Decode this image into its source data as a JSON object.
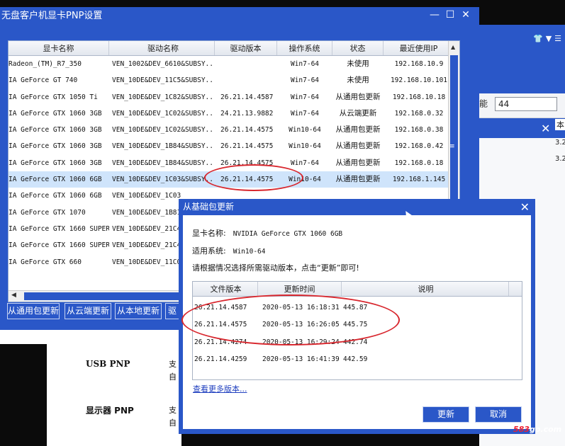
{
  "main_window": {
    "title": "无盘客户机显卡PNP设置",
    "controls": [
      "—",
      "☐",
      "✕"
    ],
    "columns": [
      "显卡名称",
      "驱动名称",
      "驱动版本",
      "操作系统",
      "状态",
      "最近使用IP"
    ],
    "rows": [
      {
        "name": "Radeon_(TM)_R7_350",
        "driver": "VEN_1002&DEV_6610&SUBSY...",
        "version": "",
        "os": "Win7-64",
        "status": "未使用",
        "ip": "192.168.10.9"
      },
      {
        "name": "IA GeForce GT 740",
        "driver": "VEN_10DE&DEV_11C5&SUBSY...",
        "version": "",
        "os": "Win7-64",
        "status": "未使用",
        "ip": "192.168.10.101"
      },
      {
        "name": "IA GeForce GTX 1050 Ti",
        "driver": "VEN_10DE&DEV_1C82&SUBSY...",
        "version": "26.21.14.4587",
        "os": "Win7-64",
        "status": "从通用包更新",
        "ip": "192.168.10.18"
      },
      {
        "name": "IA GeForce GTX 1060 3GB",
        "driver": "VEN_10DE&DEV_1C02&SUBSY...",
        "version": "24.21.13.9882",
        "os": "Win7-64",
        "status": "从云端更新",
        "ip": "192.168.0.32"
      },
      {
        "name": "IA GeForce GTX 1060 3GB",
        "driver": "VEN_10DE&DEV_1C02&SUBSY...",
        "version": "26.21.14.4575",
        "os": "Win10-64",
        "status": "从通用包更新",
        "ip": "192.168.0.38"
      },
      {
        "name": "IA GeForce GTX 1060 3GB",
        "driver": "VEN_10DE&DEV_1B84&SUBSY...",
        "version": "26.21.14.4575",
        "os": "Win10-64",
        "status": "从通用包更新",
        "ip": "192.168.0.42"
      },
      {
        "name": "IA GeForce GTX 1060 3GB",
        "driver": "VEN_10DE&DEV_1B84&SUBSY...",
        "version": "26.21.14.4575",
        "os": "Win7-64",
        "status": "从通用包更新",
        "ip": "192.168.0.18"
      },
      {
        "name": "IA GeForce GTX 1060 6GB",
        "driver": "VEN_10DE&DEV_1C03&SUBSY...",
        "version": "26.21.14.4575",
        "os": "Win10-64",
        "status": "从通用包更新",
        "ip": "192.168.1.145"
      },
      {
        "name": "IA GeForce GTX 1060 6GB",
        "driver": "VEN_10DE&DEV_1C03",
        "version": "",
        "os": "",
        "status": "",
        "ip": ""
      },
      {
        "name": "IA GeForce GTX 1070",
        "driver": "VEN_10DE&DEV_1B81",
        "version": "",
        "os": "",
        "status": "",
        "ip": ""
      },
      {
        "name": "IA GeForce GTX 1660 SUPER",
        "driver": "VEN_10DE&DEV_21C4",
        "version": "",
        "os": "",
        "status": "",
        "ip": ""
      },
      {
        "name": "IA GeForce GTX 1660 SUPER",
        "driver": "VEN_10DE&DEV_21C4",
        "version": "",
        "os": "",
        "status": "",
        "ip": ""
      },
      {
        "name": "IA GeForce GTX 660",
        "driver": "VEN_10DE&DEV_11C0",
        "version": "",
        "os": "",
        "status": "",
        "ip": ""
      }
    ],
    "selected_row": 7,
    "buttons": [
      "从通用包更新",
      "从云端更新",
      "从本地更新",
      "驱"
    ]
  },
  "background": {
    "right_icons": "👕▼☰",
    "func_label": "能",
    "func_value": "44",
    "ben_label": "本",
    "right_cells": [
      "3.2",
      "3.2"
    ],
    "usb_label": "USB PNP",
    "display_label": "显示器 PNP",
    "side_text": [
      "支",
      "自",
      "支",
      "自"
    ]
  },
  "dialog": {
    "title": "从基础包更新",
    "card_label": "显卡名称:",
    "card_value": "NVIDIA GeForce GTX 1060 6GB",
    "os_label": "适用系统:",
    "os_value": "Win10-64",
    "hint": "请根据情况选择所需驱动版本，点击“更新”即可!",
    "columns": [
      "文件版本",
      "更新时间",
      "说明"
    ],
    "versions": [
      {
        "ver": "26.21.14.4587",
        "time": "2020-05-13 16:18:31",
        "desc": "445.87"
      },
      {
        "ver": "26.21.14.4575",
        "time": "2020-05-13 16:26:05",
        "desc": "445.75"
      },
      {
        "ver": "26.21.14.4274",
        "time": "2020-05-13 16:29:24",
        "desc": "442.74"
      },
      {
        "ver": "26.21.14.4259",
        "time": "2020-05-13 16:41:39",
        "desc": "442.59"
      }
    ],
    "more_link": "查看更多版本...",
    "update_button": "更新",
    "cancel_button": "取消"
  },
  "watermark": {
    "prefix": "583",
    "suffix": "go.com"
  },
  "colors": {
    "window_blue": "#2a57c8",
    "selection": "#cfe4fb",
    "annotation_red": "#d8262d"
  }
}
